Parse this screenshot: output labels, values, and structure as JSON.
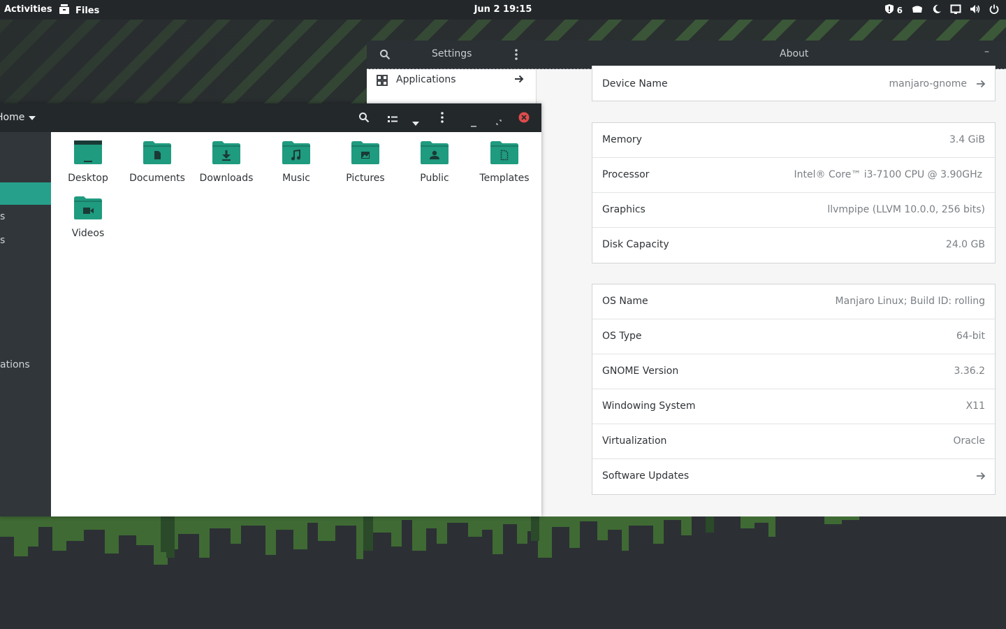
{
  "topbar": {
    "activities": "Activities",
    "app_name": "Files",
    "app_icon": "files-icon",
    "clock": "Jun 2  19:15",
    "tray_count": "6"
  },
  "settings": {
    "search_icon": "search-icon",
    "title": "Settings",
    "page_title": "About",
    "minimize": "–",
    "sidebar": [
      {
        "label": "Applications",
        "icon": "apps-grid-icon"
      }
    ],
    "device": [
      {
        "label": "Device Name",
        "value": "manjaro-gnome",
        "arrow": true
      }
    ],
    "hardware": [
      {
        "label": "Memory",
        "value": "3.4 GiB"
      },
      {
        "label": "Processor",
        "value": "Intel® Core™ i3-7100 CPU @ 3.90GHz"
      },
      {
        "label": "Graphics",
        "value": "llvmpipe (LLVM 10.0.0, 256 bits)"
      },
      {
        "label": "Disk Capacity",
        "value": "24.0 GB"
      }
    ],
    "software": [
      {
        "label": "OS Name",
        "value": "Manjaro Linux; Build ID: rolling"
      },
      {
        "label": "OS Type",
        "value": "64-bit"
      },
      {
        "label": "GNOME Version",
        "value": "3.36.2"
      },
      {
        "label": "Windowing System",
        "value": "X11"
      },
      {
        "label": "Virtualization",
        "value": "Oracle"
      },
      {
        "label": "Software Updates",
        "value": "",
        "arrow": true
      }
    ]
  },
  "files": {
    "location": "Home",
    "sidebar_fragments": [
      "s",
      "s",
      "ations"
    ],
    "items": [
      {
        "label": "Desktop",
        "icon": "desktop-folder-icon"
      },
      {
        "label": "Documents",
        "icon": "documents-folder-icon"
      },
      {
        "label": "Downloads",
        "icon": "downloads-folder-icon"
      },
      {
        "label": "Music",
        "icon": "music-folder-icon"
      },
      {
        "label": "Pictures",
        "icon": "pictures-folder-icon"
      },
      {
        "label": "Public",
        "icon": "public-folder-icon"
      },
      {
        "label": "Templates",
        "icon": "templates-folder-icon"
      },
      {
        "label": "Videos",
        "icon": "videos-folder-icon"
      }
    ]
  },
  "colors": {
    "accent": "#26a08a",
    "folder": "#1f9b7f",
    "folder_dark": "#1a7d67",
    "panel": "#23272a"
  }
}
